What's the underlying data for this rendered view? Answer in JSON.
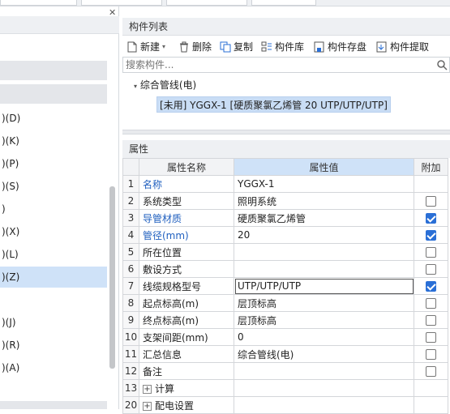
{
  "left_panel": {
    "items": [
      {
        "label": ")(D)",
        "selected": false
      },
      {
        "label": ")(K)",
        "selected": false
      },
      {
        "label": ")(P)",
        "selected": false
      },
      {
        "label": ")(S)",
        "selected": false
      },
      {
        "label": ")",
        "selected": false
      },
      {
        "label": ")(X)",
        "selected": false
      },
      {
        "label": ")(L)",
        "selected": false
      },
      {
        "label": ")(Z)",
        "selected": true
      },
      {
        "label": ")(J)",
        "selected": false
      },
      {
        "label": ")(R)",
        "selected": false
      },
      {
        "label": ")(A)",
        "selected": false
      }
    ]
  },
  "component_list": {
    "title": "构件列表",
    "toolbar": {
      "new": "新建",
      "delete": "删除",
      "copy": "复制",
      "library": "构件库",
      "save": "构件存盘",
      "extract": "构件提取"
    },
    "search_placeholder": "搜索构件...",
    "tree": {
      "group": "综合管线(电)",
      "item": "[未用] YGGX-1 [硬质聚氯乙烯管 20 UTP/UTP/UTP]"
    }
  },
  "properties": {
    "title": "属性",
    "headers": {
      "name": "属性名称",
      "value": "属性值",
      "extra": "附加"
    },
    "rows": [
      {
        "n": "1",
        "name": "名称",
        "value": "YGGX-1",
        "blue": true,
        "check": null
      },
      {
        "n": "2",
        "name": "系统类型",
        "value": "照明系统",
        "blue": false,
        "check": false
      },
      {
        "n": "3",
        "name": "导管材质",
        "value": "硬质聚氯乙烯管",
        "blue": true,
        "check": true
      },
      {
        "n": "4",
        "name": "管径(mm)",
        "value": "20",
        "blue": true,
        "check": true
      },
      {
        "n": "5",
        "name": "所在位置",
        "value": "",
        "blue": false,
        "check": false
      },
      {
        "n": "6",
        "name": "敷设方式",
        "value": "",
        "blue": false,
        "check": false
      },
      {
        "n": "7",
        "name": "线缆规格型号",
        "value": "UTP/UTP/UTP",
        "blue": false,
        "check": true,
        "editing": true
      },
      {
        "n": "8",
        "name": "起点标高(m)",
        "value": "层顶标高",
        "blue": false,
        "check": false
      },
      {
        "n": "9",
        "name": "终点标高(m)",
        "value": "层顶标高",
        "blue": false,
        "check": false
      },
      {
        "n": "10",
        "name": "支架间距(mm)",
        "value": "0",
        "blue": false,
        "check": false
      },
      {
        "n": "11",
        "name": "汇总信息",
        "value": "综合管线(电)",
        "blue": false,
        "check": false
      },
      {
        "n": "12",
        "name": "备注",
        "value": "",
        "blue": false,
        "check": false
      },
      {
        "n": "13",
        "name": "计算",
        "value": "",
        "blue": false,
        "check": null,
        "expand": true
      },
      {
        "n": "20",
        "name": "配电设置",
        "value": "",
        "blue": false,
        "check": null,
        "expand": true
      }
    ]
  },
  "colors": {
    "accent": "#2a6fd6",
    "selection": "#cfe2f8",
    "link_blue": "#1f5fbf"
  }
}
